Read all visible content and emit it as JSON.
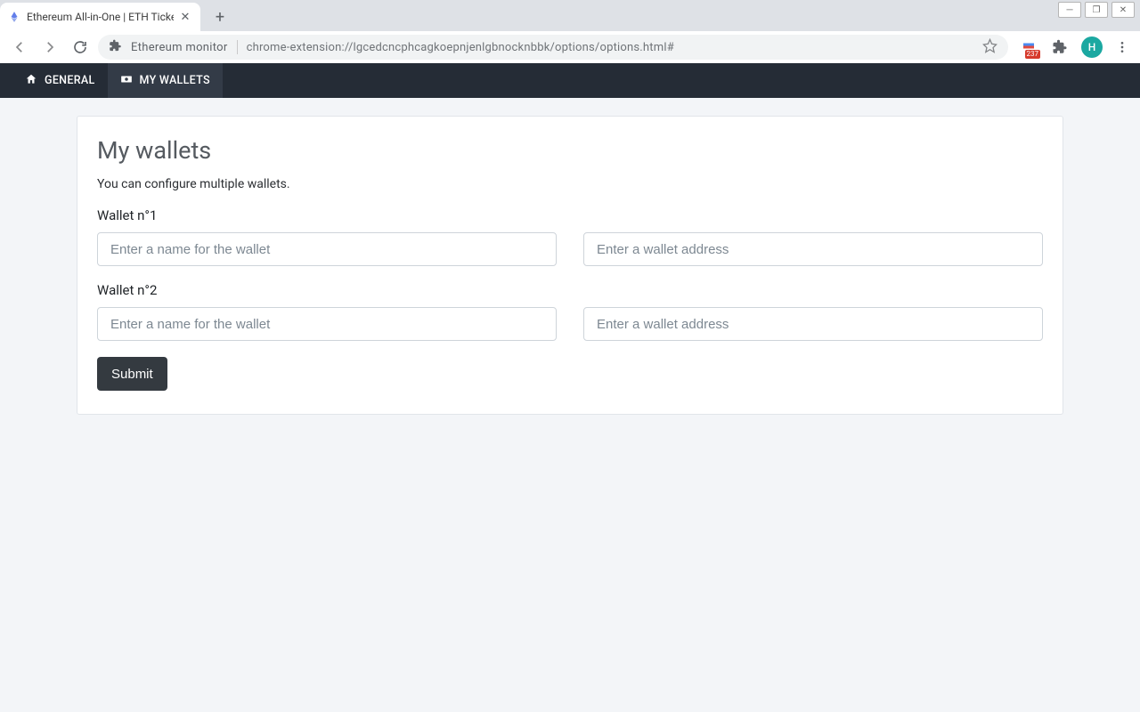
{
  "browser": {
    "tab_title": "Ethereum All-in-One | ETH Ticker",
    "omnibox_label": "Ethereum monitor",
    "url": "chrome-extension://lgcedcncphcagkoepnjenlgbnocknbbk/options/options.html#",
    "ext_badge_value": "237",
    "profile_letter": "H"
  },
  "nav": {
    "general": "GENERAL",
    "wallets": "MY WALLETS"
  },
  "page": {
    "title": "My wallets",
    "description": "You can configure multiple wallets.",
    "wallets": [
      {
        "label": "Wallet n°1"
      },
      {
        "label": "Wallet n°2"
      }
    ],
    "placeholders": {
      "name": "Enter a name for the wallet",
      "address": "Enter a wallet address"
    },
    "submit": "Submit"
  }
}
